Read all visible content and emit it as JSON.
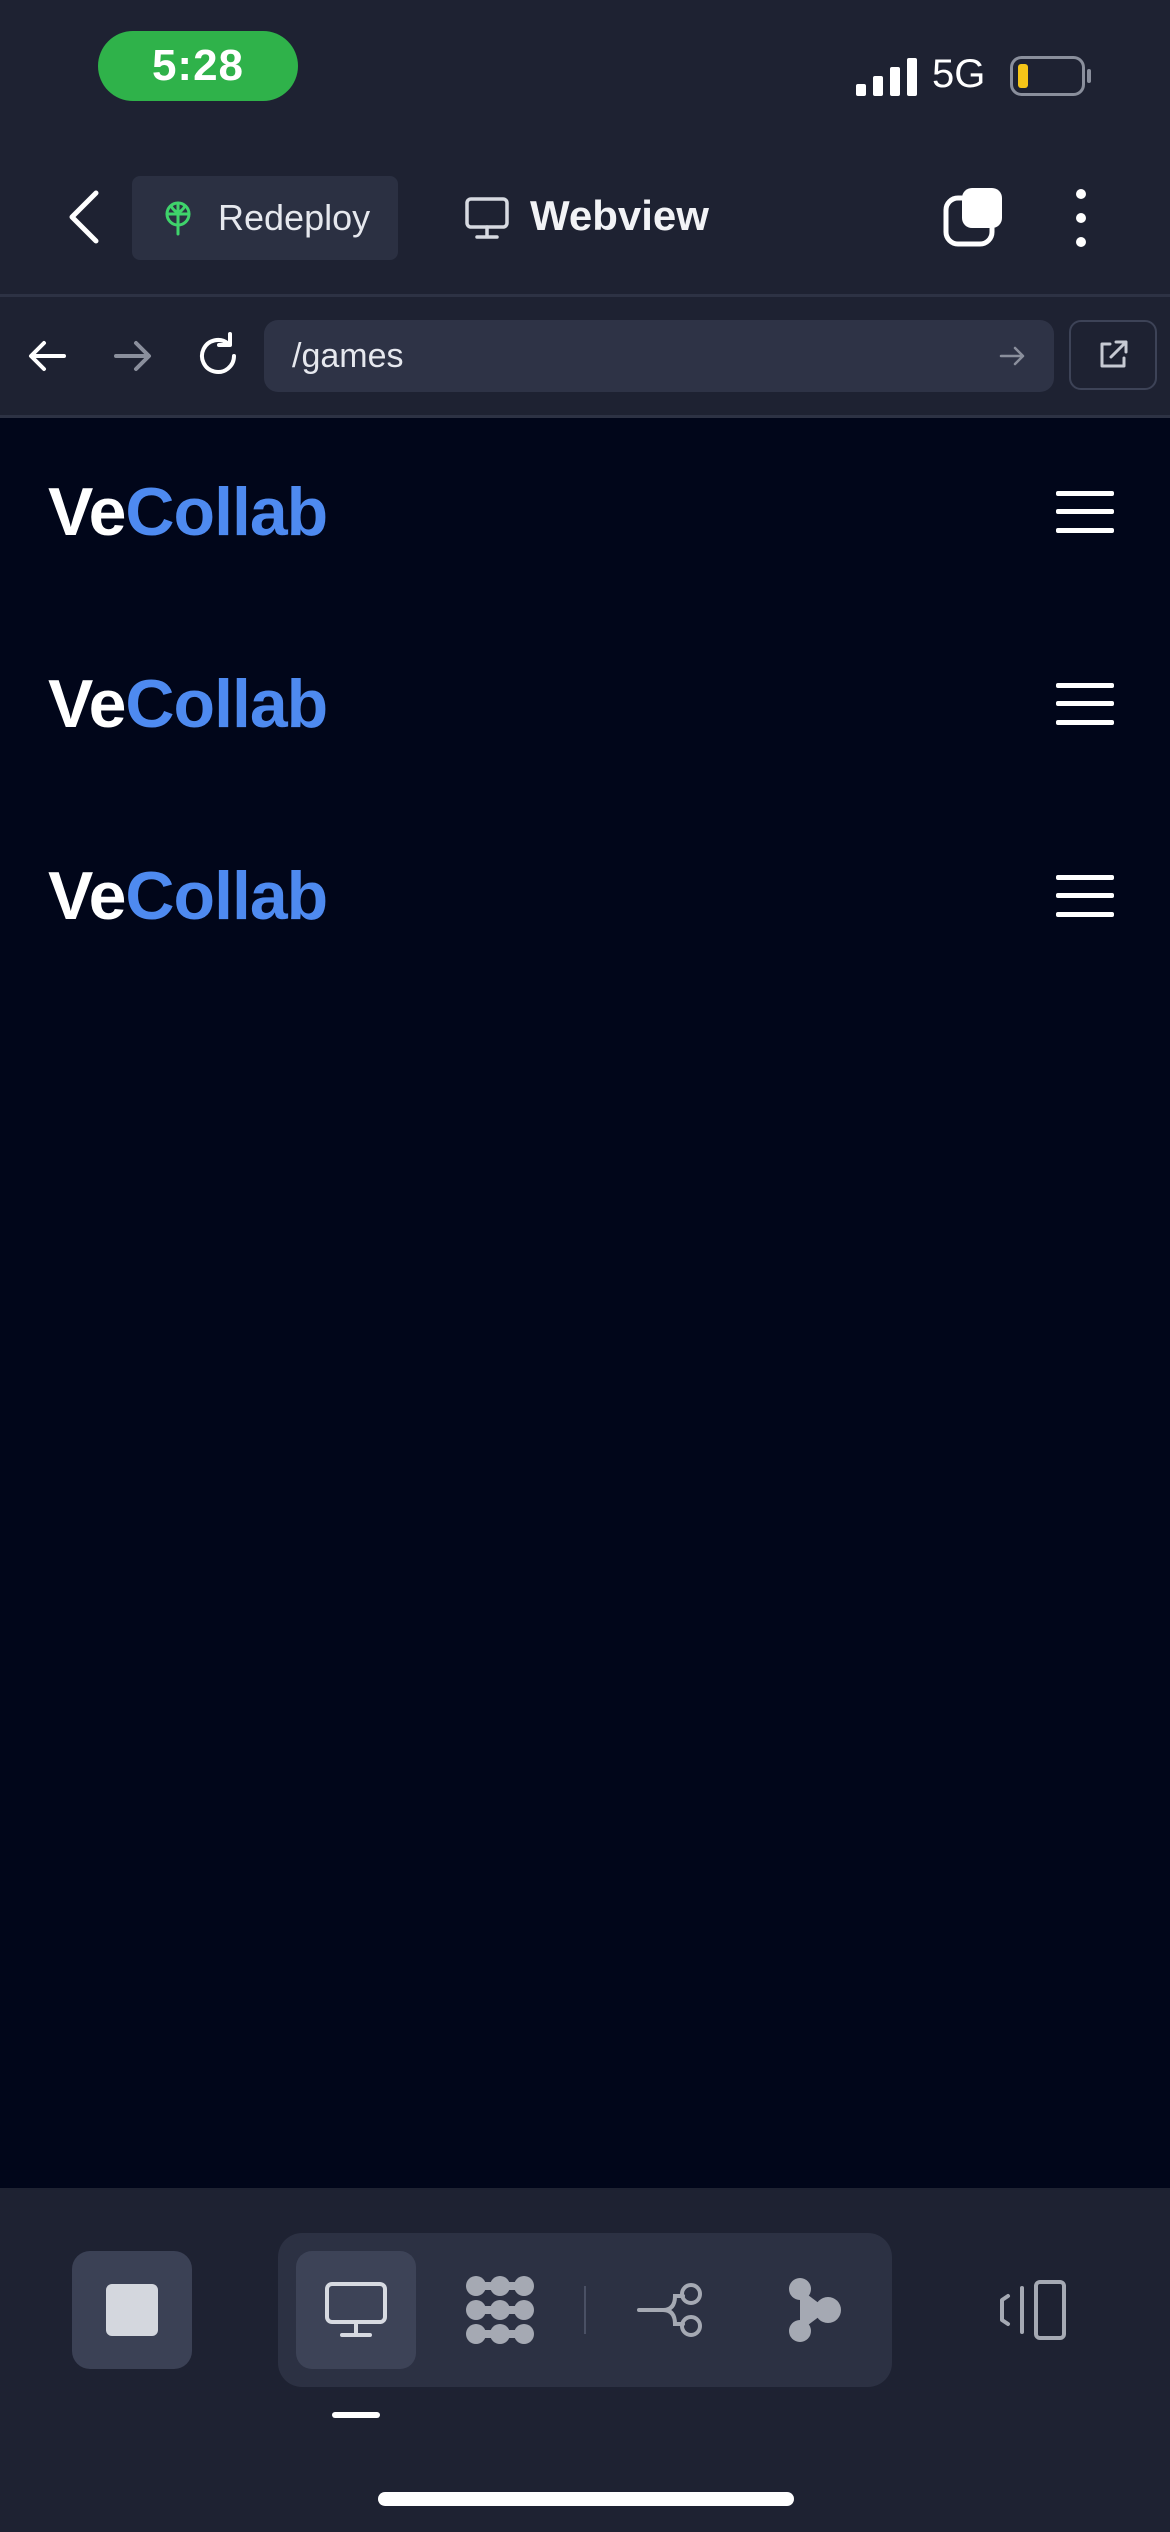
{
  "status_bar": {
    "time": "5:28",
    "network": "5G",
    "battery_color": "#f5c518"
  },
  "header": {
    "redeploy_label": "Redeploy",
    "title": "Webview"
  },
  "url_bar": {
    "path": "/games"
  },
  "site": {
    "rows": [
      {
        "logo_part1": "Ve",
        "logo_part2": "Collab"
      },
      {
        "logo_part1": "Ve",
        "logo_part2": "Collab"
      },
      {
        "logo_part1": "Ve",
        "logo_part2": "Collab"
      }
    ],
    "brand_color": "#4e8af0"
  },
  "dock": {
    "stop": "stop-icon",
    "tools": [
      "webview-icon",
      "assets-icon",
      "graph-icon",
      "pipeline-icon"
    ],
    "active_tool": "webview-icon",
    "panel": "panel-toggle-icon"
  },
  "colors": {
    "accent_green": "#2fb24a",
    "content_bg": "#01061a",
    "chrome_bg": "#1e2232"
  }
}
